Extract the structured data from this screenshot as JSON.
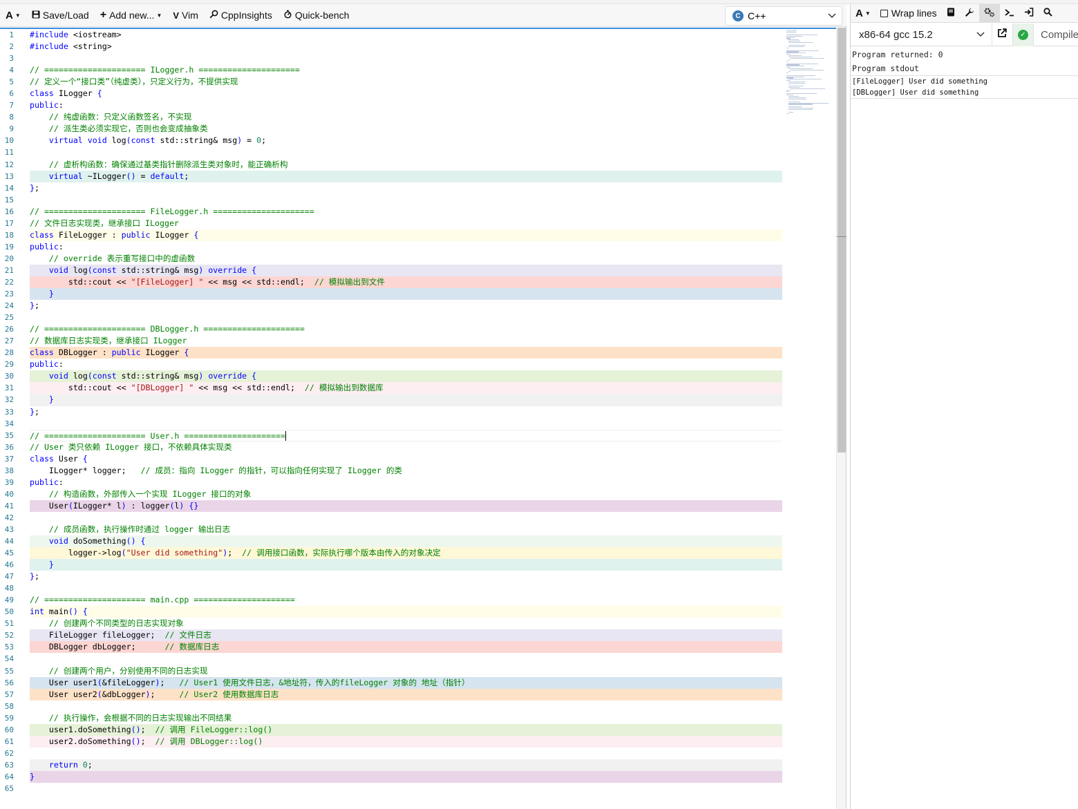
{
  "toolbar": {
    "font_btn": "A",
    "save_load": "Save/Load",
    "add_new": "Add new...",
    "vim": "Vim",
    "cppinsights": "CppInsights",
    "quickbench": "Quick-bench",
    "language": "C++"
  },
  "output_toolbar": {
    "font_btn": "A",
    "wrap_lines": "Wrap lines"
  },
  "compiler": {
    "name": "x86-64 gcc 15.2",
    "compile_label": "Compile"
  },
  "output": {
    "returned": "Program returned: 0",
    "stdout_label": "Program stdout",
    "stdout_lines": [
      "[FileLogger] User did something",
      "[DBLogger] User did something"
    ]
  },
  "colors": {
    "accent": "#3b8ede",
    "comment": "#008000",
    "keyword": "#0000ff",
    "string": "#a31515",
    "number": "#098658",
    "status_ok": "#28a745"
  },
  "code_lines": [
    {
      "n": 1,
      "bg": "",
      "toks": [
        [
          "k",
          "#include "
        ],
        [
          "t",
          "<iostream>"
        ]
      ]
    },
    {
      "n": 2,
      "bg": "",
      "toks": [
        [
          "k",
          "#include "
        ],
        [
          "t",
          "<string>"
        ]
      ]
    },
    {
      "n": 3,
      "bg": "",
      "toks": []
    },
    {
      "n": 4,
      "bg": "",
      "toks": [
        [
          "c",
          "// ===================== ILogger.h ====================="
        ]
      ]
    },
    {
      "n": 5,
      "bg": "",
      "toks": [
        [
          "c",
          "// 定义一个“接口类”（纯虚类），只定义行为，不提供实现"
        ]
      ]
    },
    {
      "n": 6,
      "bg": "",
      "toks": [
        [
          "k",
          "class "
        ],
        [
          "t",
          "ILogger "
        ],
        [
          "p",
          "{"
        ]
      ]
    },
    {
      "n": 7,
      "bg": "",
      "toks": [
        [
          "k",
          "public"
        ],
        [
          "t",
          ":"
        ]
      ]
    },
    {
      "n": 8,
      "bg": "",
      "toks": [
        [
          "t",
          "    "
        ],
        [
          "c",
          "// 纯虚函数：只定义函数签名，不实现"
        ]
      ]
    },
    {
      "n": 9,
      "bg": "",
      "toks": [
        [
          "t",
          "    "
        ],
        [
          "c",
          "// 派生类必须实现它，否则也会变成抽象类"
        ]
      ]
    },
    {
      "n": 10,
      "bg": "",
      "toks": [
        [
          "t",
          "    "
        ],
        [
          "k",
          "virtual void "
        ],
        [
          "t",
          "log"
        ],
        [
          "p",
          "("
        ],
        [
          "k",
          "const "
        ],
        [
          "t",
          "std::string& msg"
        ],
        [
          "p",
          ")"
        ],
        [
          "t",
          " = "
        ],
        [
          "n",
          "0"
        ],
        [
          "t",
          ";"
        ]
      ]
    },
    {
      "n": 11,
      "bg": "",
      "toks": []
    },
    {
      "n": 12,
      "bg": "",
      "toks": [
        [
          "t",
          "    "
        ],
        [
          "c",
          "// 虚析构函数：确保通过基类指针删除派生类对象时，能正确析构"
        ]
      ]
    },
    {
      "n": 13,
      "bg": "#dff2ee",
      "toks": [
        [
          "t",
          "    "
        ],
        [
          "k",
          "virtual "
        ],
        [
          "t",
          "~ILogger"
        ],
        [
          "p",
          "()"
        ],
        [
          "t",
          " = "
        ],
        [
          "k",
          "default"
        ],
        [
          "t",
          ";"
        ]
      ]
    },
    {
      "n": 14,
      "bg": "",
      "toks": [
        [
          "p",
          "}"
        ],
        [
          "t",
          ";"
        ]
      ]
    },
    {
      "n": 15,
      "bg": "",
      "toks": []
    },
    {
      "n": 16,
      "bg": "",
      "toks": [
        [
          "c",
          "// ===================== FileLogger.h ====================="
        ]
      ]
    },
    {
      "n": 17,
      "bg": "",
      "toks": [
        [
          "c",
          "// 文件日志实现类，继承接口 ILogger"
        ]
      ]
    },
    {
      "n": 18,
      "bg": "#fffde8",
      "toks": [
        [
          "k",
          "class "
        ],
        [
          "t",
          "FileLogger : "
        ],
        [
          "k",
          "public "
        ],
        [
          "t",
          "ILogger "
        ],
        [
          "p",
          "{"
        ]
      ]
    },
    {
      "n": 19,
      "bg": "",
      "toks": [
        [
          "k",
          "public"
        ],
        [
          "t",
          ":"
        ]
      ]
    },
    {
      "n": 20,
      "bg": "",
      "toks": [
        [
          "t",
          "    "
        ],
        [
          "c",
          "// override 表示重写接口中的虚函数"
        ]
      ]
    },
    {
      "n": 21,
      "bg": "#e8e6f3",
      "toks": [
        [
          "t",
          "    "
        ],
        [
          "k",
          "void "
        ],
        [
          "t",
          "log"
        ],
        [
          "p",
          "("
        ],
        [
          "k",
          "const "
        ],
        [
          "t",
          "std::string& msg"
        ],
        [
          "p",
          ")"
        ],
        [
          "t",
          " "
        ],
        [
          "k",
          "override "
        ],
        [
          "p",
          "{"
        ]
      ]
    },
    {
      "n": 22,
      "bg": "#fcd6d3",
      "toks": [
        [
          "t",
          "        std::cout << "
        ],
        [
          "s",
          "\"[FileLogger] \""
        ],
        [
          "t",
          " << msg << std::endl;  "
        ],
        [
          "c",
          "// 模拟输出到文件"
        ]
      ]
    },
    {
      "n": 23,
      "bg": "#d6e4f0",
      "toks": [
        [
          "t",
          "    "
        ],
        [
          "p",
          "}"
        ]
      ]
    },
    {
      "n": 24,
      "bg": "",
      "toks": [
        [
          "p",
          "}"
        ],
        [
          "t",
          ";"
        ]
      ]
    },
    {
      "n": 25,
      "bg": "",
      "toks": []
    },
    {
      "n": 26,
      "bg": "",
      "toks": [
        [
          "c",
          "// ===================== DBLogger.h ====================="
        ]
      ]
    },
    {
      "n": 27,
      "bg": "",
      "toks": [
        [
          "c",
          "// 数据库日志实现类，继承接口 ILogger"
        ]
      ]
    },
    {
      "n": 28,
      "bg": "#fde2c8",
      "toks": [
        [
          "k",
          "class "
        ],
        [
          "t",
          "DBLogger : "
        ],
        [
          "k",
          "public "
        ],
        [
          "t",
          "ILogger "
        ],
        [
          "p",
          "{"
        ]
      ]
    },
    {
      "n": 29,
      "bg": "",
      "toks": [
        [
          "k",
          "public"
        ],
        [
          "t",
          ":"
        ]
      ]
    },
    {
      "n": 30,
      "bg": "#e6f2d8",
      "toks": [
        [
          "t",
          "    "
        ],
        [
          "k",
          "void "
        ],
        [
          "t",
          "log"
        ],
        [
          "p",
          "("
        ],
        [
          "k",
          "const "
        ],
        [
          "t",
          "std::string& msg"
        ],
        [
          "p",
          ")"
        ],
        [
          "t",
          " "
        ],
        [
          "k",
          "override "
        ],
        [
          "p",
          "{"
        ]
      ]
    },
    {
      "n": 31,
      "bg": "#fdeef2",
      "toks": [
        [
          "t",
          "        std::cout << "
        ],
        [
          "s",
          "\"[DBLogger] \""
        ],
        [
          "t",
          " << msg << std::endl;  "
        ],
        [
          "c",
          "// 模拟输出到数据库"
        ]
      ]
    },
    {
      "n": 32,
      "bg": "#f1f1f1",
      "toks": [
        [
          "t",
          "    "
        ],
        [
          "p",
          "}"
        ]
      ]
    },
    {
      "n": 33,
      "bg": "",
      "toks": [
        [
          "p",
          "}"
        ],
        [
          "t",
          ";"
        ]
      ]
    },
    {
      "n": 34,
      "bg": "",
      "toks": []
    },
    {
      "n": 35,
      "bg": "",
      "active": true,
      "toks": [
        [
          "c",
          "// ===================== User.h ====================="
        ]
      ]
    },
    {
      "n": 36,
      "bg": "",
      "toks": [
        [
          "c",
          "// User 类只依赖 ILogger 接口，不依赖具体实现类"
        ]
      ]
    },
    {
      "n": 37,
      "bg": "",
      "toks": [
        [
          "k",
          "class "
        ],
        [
          "t",
          "User "
        ],
        [
          "p",
          "{"
        ]
      ]
    },
    {
      "n": 38,
      "bg": "",
      "toks": [
        [
          "t",
          "    ILogger* logger;   "
        ],
        [
          "c",
          "// 成员：指向 ILogger 的指针，可以指向任何实现了 ILogger 的类"
        ]
      ]
    },
    {
      "n": 39,
      "bg": "",
      "toks": [
        [
          "k",
          "public"
        ],
        [
          "t",
          ":"
        ]
      ]
    },
    {
      "n": 40,
      "bg": "",
      "toks": [
        [
          "t",
          "    "
        ],
        [
          "c",
          "// 构造函数，外部传入一个实现 ILogger 接口的对象"
        ]
      ]
    },
    {
      "n": 41,
      "bg": "#ead5e8",
      "toks": [
        [
          "t",
          "    User"
        ],
        [
          "p",
          "("
        ],
        [
          "t",
          "ILogger* l"
        ],
        [
          "p",
          ")"
        ],
        [
          "t",
          " : logger"
        ],
        [
          "p",
          "("
        ],
        [
          "t",
          "l"
        ],
        [
          "p",
          ") {}"
        ]
      ]
    },
    {
      "n": 42,
      "bg": "",
      "toks": []
    },
    {
      "n": 43,
      "bg": "",
      "toks": [
        [
          "t",
          "    "
        ],
        [
          "c",
          "// 成员函数，执行操作时通过 logger 输出日志"
        ]
      ]
    },
    {
      "n": 44,
      "bg": "#eef7ee",
      "toks": [
        [
          "t",
          "    "
        ],
        [
          "k",
          "void "
        ],
        [
          "t",
          "doSomething"
        ],
        [
          "p",
          "() {"
        ]
      ]
    },
    {
      "n": 45,
      "bg": "#fff8d8",
      "toks": [
        [
          "t",
          "        logger->log"
        ],
        [
          "p",
          "("
        ],
        [
          "s",
          "\"User did something\""
        ],
        [
          "p",
          ")"
        ],
        [
          "t",
          ";  "
        ],
        [
          "c",
          "// 调用接口函数，实际执行哪个版本由传入的对象决定"
        ]
      ]
    },
    {
      "n": 46,
      "bg": "#dff2ee",
      "toks": [
        [
          "t",
          "    "
        ],
        [
          "p",
          "}"
        ]
      ]
    },
    {
      "n": 47,
      "bg": "",
      "toks": [
        [
          "p",
          "}"
        ],
        [
          "t",
          ";"
        ]
      ]
    },
    {
      "n": 48,
      "bg": "",
      "toks": []
    },
    {
      "n": 49,
      "bg": "",
      "toks": [
        [
          "c",
          "// ===================== main.cpp ====================="
        ]
      ]
    },
    {
      "n": 50,
      "bg": "#fffde8",
      "toks": [
        [
          "k",
          "int "
        ],
        [
          "t",
          "main"
        ],
        [
          "p",
          "() {"
        ]
      ]
    },
    {
      "n": 51,
      "bg": "",
      "toks": [
        [
          "t",
          "    "
        ],
        [
          "c",
          "// 创建两个不同类型的日志实现对象"
        ]
      ]
    },
    {
      "n": 52,
      "bg": "#e8e6f3",
      "toks": [
        [
          "t",
          "    FileLogger fileLogger;  "
        ],
        [
          "c",
          "// 文件日志"
        ]
      ]
    },
    {
      "n": 53,
      "bg": "#fcd6d3",
      "toks": [
        [
          "t",
          "    DBLogger dbLogger;      "
        ],
        [
          "c",
          "// 数据库日志"
        ]
      ]
    },
    {
      "n": 54,
      "bg": "",
      "toks": []
    },
    {
      "n": 55,
      "bg": "",
      "toks": [
        [
          "t",
          "    "
        ],
        [
          "c",
          "// 创建两个用户，分别使用不同的日志实现"
        ]
      ]
    },
    {
      "n": 56,
      "bg": "#d6e4f0",
      "toks": [
        [
          "t",
          "    User user1"
        ],
        [
          "p",
          "("
        ],
        [
          "t",
          "&fileLogger"
        ],
        [
          "p",
          ")"
        ],
        [
          "t",
          ";   "
        ],
        [
          "c",
          "// User1 使用文件日志，&地址符，传入的fileLogger 对象的 地址（指针）"
        ]
      ]
    },
    {
      "n": 57,
      "bg": "#fde2c8",
      "toks": [
        [
          "t",
          "    User user2"
        ],
        [
          "p",
          "("
        ],
        [
          "t",
          "&dbLogger"
        ],
        [
          "p",
          ")"
        ],
        [
          "t",
          ";     "
        ],
        [
          "c",
          "// User2 使用数据库日志"
        ]
      ]
    },
    {
      "n": 58,
      "bg": "",
      "toks": []
    },
    {
      "n": 59,
      "bg": "",
      "toks": [
        [
          "t",
          "    "
        ],
        [
          "c",
          "// 执行操作，会根据不同的日志实现输出不同结果"
        ]
      ]
    },
    {
      "n": 60,
      "bg": "#e6f2d8",
      "toks": [
        [
          "t",
          "    user1.doSomething"
        ],
        [
          "p",
          "()"
        ],
        [
          "t",
          ";  "
        ],
        [
          "c",
          "// 调用 FileLogger::log()"
        ]
      ]
    },
    {
      "n": 61,
      "bg": "#fdeef2",
      "toks": [
        [
          "t",
          "    user2.doSomething"
        ],
        [
          "p",
          "()"
        ],
        [
          "t",
          ";  "
        ],
        [
          "c",
          "// 调用 DBLogger::log()"
        ]
      ]
    },
    {
      "n": 62,
      "bg": "",
      "toks": []
    },
    {
      "n": 63,
      "bg": "#f1f1f1",
      "toks": [
        [
          "t",
          "    "
        ],
        [
          "k",
          "return "
        ],
        [
          "n",
          "0"
        ],
        [
          "t",
          ";"
        ]
      ]
    },
    {
      "n": 64,
      "bg": "#ead5e8",
      "toks": [
        [
          "p",
          "}"
        ]
      ]
    },
    {
      "n": 65,
      "bg": "",
      "toks": []
    }
  ]
}
